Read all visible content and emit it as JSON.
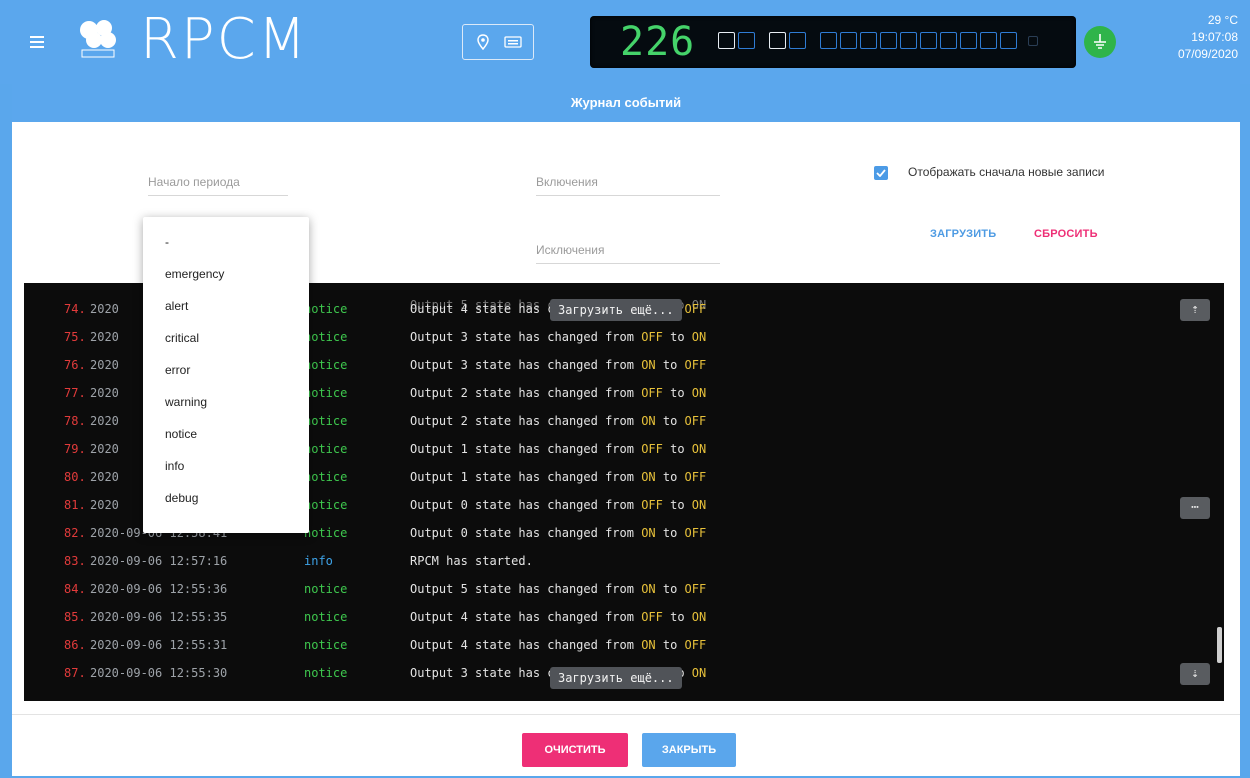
{
  "header": {
    "brand": "RPCM",
    "display_value": "226",
    "temperature": "29 °C",
    "time": "19:07:08",
    "date": "07/09/2020"
  },
  "dialog": {
    "title": "Журнал событий",
    "period_start_placeholder": "Начало периода",
    "include_placeholder": "Включения",
    "exclude_placeholder": "Исключения",
    "show_newest_label": "Отображать сначала новые записи",
    "show_newest_checked": true,
    "load_label": "ЗАГРУЗИТЬ",
    "reset_label": "СБРОСИТЬ",
    "clear_label": "ОЧИСТИТЬ",
    "close_label": "ЗАКРЫТЬ"
  },
  "dropdown": {
    "options": [
      "-",
      "emergency",
      "alert",
      "critical",
      "error",
      "warning",
      "notice",
      "info",
      "debug"
    ]
  },
  "log": {
    "load_more_label": "Загрузить ещё...",
    "rows": [
      {
        "num": "74.",
        "date": "2020",
        "level": "notice",
        "msg_pre": "Output 4 state has changed from ",
        "from": "ON",
        "to": "OFF"
      },
      {
        "num": "75.",
        "date": "2020",
        "level": "notice",
        "msg_pre": "Output 3 state has changed from ",
        "from": "OFF",
        "to": "ON"
      },
      {
        "num": "76.",
        "date": "2020",
        "level": "notice",
        "msg_pre": "Output 3 state has changed from ",
        "from": "ON",
        "to": "OFF"
      },
      {
        "num": "77.",
        "date": "2020",
        "level": "notice",
        "msg_pre": "Output 2 state has changed from ",
        "from": "OFF",
        "to": "ON"
      },
      {
        "num": "78.",
        "date": "2020",
        "level": "notice",
        "msg_pre": "Output 2 state has changed from ",
        "from": "ON",
        "to": "OFF"
      },
      {
        "num": "79.",
        "date": "2020",
        "level": "notice",
        "msg_pre": "Output 1 state has changed from ",
        "from": "OFF",
        "to": "ON"
      },
      {
        "num": "80.",
        "date": "2020",
        "level": "notice",
        "msg_pre": "Output 1 state has changed from ",
        "from": "ON",
        "to": "OFF"
      },
      {
        "num": "81.",
        "date": "2020",
        "level": "notice",
        "msg_pre": "Output 0 state has changed from ",
        "from": "OFF",
        "to": "ON"
      },
      {
        "num": "82.",
        "date": "2020-09-06 12:58:41",
        "level": "notice",
        "msg_pre": "Output 0 state has changed from ",
        "from": "ON",
        "to": "OFF"
      },
      {
        "num": "83.",
        "date": "2020-09-06 12:57:16",
        "level": "info",
        "msg_pre": "RPCM has started.",
        "from": "",
        "to": ""
      },
      {
        "num": "84.",
        "date": "2020-09-06 12:55:36",
        "level": "notice",
        "msg_pre": "Output 5 state has changed from ",
        "from": "ON",
        "to": "OFF"
      },
      {
        "num": "85.",
        "date": "2020-09-06 12:55:35",
        "level": "notice",
        "msg_pre": "Output 4 state has changed from ",
        "from": "OFF",
        "to": "ON"
      },
      {
        "num": "86.",
        "date": "2020-09-06 12:55:31",
        "level": "notice",
        "msg_pre": "Output 4 state has changed from ",
        "from": "ON",
        "to": "OFF"
      },
      {
        "num": "87.",
        "date": "2020-09-06 12:55:30",
        "level": "notice",
        "msg_pre": "Output 3 state has changed from ",
        "from": "OFF",
        "to": "ON"
      }
    ]
  },
  "colors": {
    "brand_blue": "#5ba7ed",
    "accent_pink": "#ee2f76",
    "button_blue": "#5aa6ec",
    "notice_green": "#3ec84e",
    "info_blue": "#3ea3e8",
    "highlight_yellow": "#e7c13a",
    "line_number_red": "#e23b3b"
  },
  "icons": {
    "menu": "hamburger-icon",
    "logo": "rpcm-logo-icon",
    "location": "map-pin-icon",
    "keyboard": "keyboard-icon",
    "ground": "ground-icon",
    "scroll_top": "arrow-up-icon",
    "scroll_bottom": "arrow-down-icon",
    "expand": "ellipsis-icon"
  }
}
